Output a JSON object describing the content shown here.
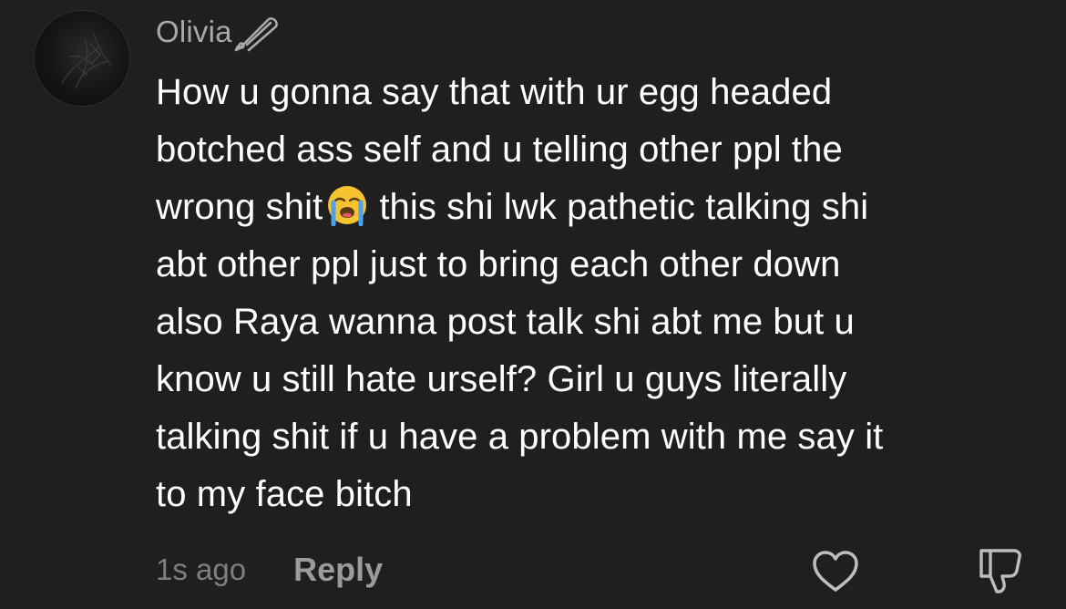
{
  "comment": {
    "username": "Olivia",
    "username_badge_icon": "safety-pin-icon",
    "avatar_icon": "dark-profile-photo",
    "body_lines": {
      "l1": "How u gonna say that with ur egg headed",
      "l2": "botched ass self and u telling other ppl the",
      "l3a": "wrong shit",
      "l3_emoji": "loudly-crying-face-emoji",
      "l3b": "this shi lwk pathetic talking shi",
      "l4": "abt other ppl just to bring each other down",
      "l5": "also Raya wanna post talk shi abt me but u",
      "l6": "know u still hate urself? Girl u guys literally",
      "l7": "talking shit if u have a problem with me say it",
      "l8": "to my face bitch"
    },
    "timestamp": "1s ago",
    "reply_label": "Reply",
    "like_icon": "heart-outline-icon",
    "dislike_icon": "thumbs-down-outline-icon"
  },
  "colors": {
    "background": "#1f1f1f",
    "text_primary": "#ffffff",
    "text_username": "#a9a9a9",
    "text_muted": "#7f7f7f"
  }
}
